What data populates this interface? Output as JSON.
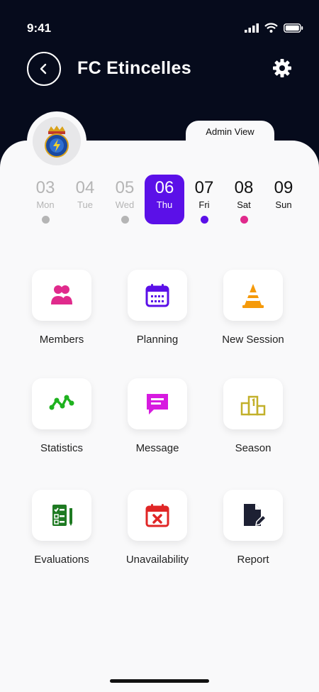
{
  "status": {
    "time": "9:41"
  },
  "header": {
    "title": "FC Etincelles",
    "admin_label": "Admin View"
  },
  "days": [
    {
      "num": "03",
      "name": "Mon",
      "state": "past",
      "dot": "#b5b5b5"
    },
    {
      "num": "04",
      "name": "Tue",
      "state": "past",
      "dot": null
    },
    {
      "num": "05",
      "name": "Wed",
      "state": "past",
      "dot": "#b5b5b5"
    },
    {
      "num": "06",
      "name": "Thu",
      "state": "selected",
      "dot": null
    },
    {
      "num": "07",
      "name": "Fri",
      "state": "future",
      "dot": "#5b10e8"
    },
    {
      "num": "08",
      "name": "Sat",
      "state": "future",
      "dot": "#e02a8c"
    },
    {
      "num": "09",
      "name": "Sun",
      "state": "future",
      "dot": null
    }
  ],
  "menu": [
    {
      "label": "Members",
      "icon": "members-icon",
      "color": "#e02a8c"
    },
    {
      "label": "Planning",
      "icon": "calendar-icon",
      "color": "#5b10e8"
    },
    {
      "label": "New Session",
      "icon": "cone-icon",
      "color": "#f59a0a"
    },
    {
      "label": "Statistics",
      "icon": "chart-line-icon",
      "color": "#1fb21f"
    },
    {
      "label": "Message",
      "icon": "message-icon",
      "color": "#d71ae0"
    },
    {
      "label": "Season",
      "icon": "podium-icon",
      "color": "#c2b02a"
    },
    {
      "label": "Evaluations",
      "icon": "checklist-icon",
      "color": "#1e7a22"
    },
    {
      "label": "Unavailability",
      "icon": "calendar-x-icon",
      "color": "#e02626"
    },
    {
      "label": "Report",
      "icon": "report-edit-icon",
      "color": "#1d2033"
    }
  ],
  "colors": {
    "accent": "#5b10e8",
    "header_bg": "#060b1c",
    "muted": "#b5b5b5"
  }
}
